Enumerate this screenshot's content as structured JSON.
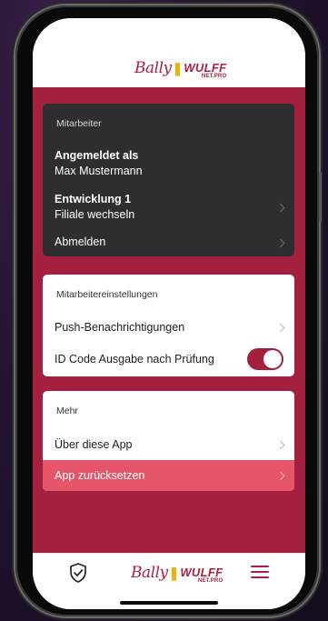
{
  "brand": {
    "name_left": "Bally",
    "separator": "❚",
    "name_right": "WULFF",
    "sub": "NET.PRO",
    "color": "#a8213f"
  },
  "colors": {
    "accent": "#a3203e",
    "dark_card": "#2e2e31",
    "danger": "#e6566a"
  },
  "employee": {
    "section": "Mitarbeiter",
    "logged_in_label": "Angemeldet als",
    "user_name": "Max Mustermann",
    "branch_name": "Entwicklung 1",
    "branch_action": "Filiale wechseln",
    "logout": "Abmelden"
  },
  "settings": {
    "section": "Mitarbeitereinstellungen",
    "push": "Push-Benachrichtigungen",
    "id_code": "ID Code Ausgabe nach Prüfung",
    "id_code_enabled": true
  },
  "more": {
    "section": "Mehr",
    "about": "Über diese App",
    "reset": "App zurücksetzen"
  },
  "tabbar": {
    "left_icon": "shield-check-icon",
    "right_icon": "hamburger-menu-icon"
  }
}
